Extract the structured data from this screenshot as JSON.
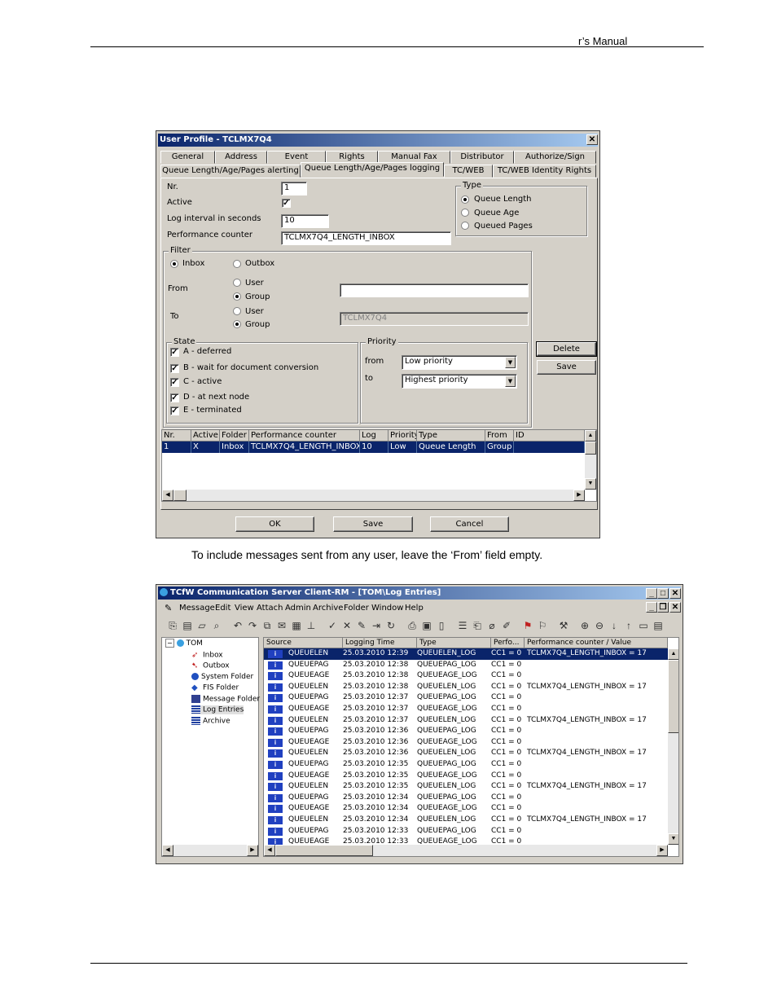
{
  "page": {
    "header_text": "r’s Manual",
    "caption": "To include messages sent from any user, leave the ‘From’ field empty."
  },
  "dialog": {
    "title": "User Profile - TCLMX7Q4",
    "close_label": "✕",
    "tabs_row1": [
      "General",
      "Address",
      "Event",
      "Rights",
      "Manual Fax",
      "Distributor",
      "Authorize/Sign"
    ],
    "tabs_row2": [
      "Queue Length/Age/Pages alerting",
      "Queue Length/Age/Pages logging",
      "TC/WEB",
      "TC/WEB Identity Rights"
    ],
    "nr_label": "Nr.",
    "nr_value": "1",
    "active_label": "Active",
    "active_checked": "✓",
    "interval_label": "Log interval in seconds",
    "interval_value": "10",
    "perf_label": "Performance counter",
    "perf_value": "TCLMX7Q4_LENGTH_INBOX",
    "type_group": "Type",
    "type_options": [
      "Queue Length",
      "Queue Age",
      "Queued Pages"
    ],
    "filter_group": "Filter",
    "inbox_label": "Inbox",
    "outbox_label": "Outbox",
    "from_label": "From",
    "to_label": "To",
    "user_label": "User",
    "group_label": "Group",
    "from_value": "",
    "to_value": "TCLMX7Q4",
    "state_group": "State",
    "states": [
      "A - deferred",
      "B - wait for document conversion",
      "C - active",
      "D - at next node",
      "E - terminated"
    ],
    "priority_group": "Priority",
    "prio_from_label": "from",
    "prio_from_value": "Low priority",
    "prio_to_label": "to",
    "prio_to_value": "Highest priority",
    "delete_label": "Delete",
    "save_side_label": "Save",
    "grid_headers": [
      "Nr.",
      "Active",
      "Folder",
      "Performance counter",
      "Log",
      "Priority",
      "Type",
      "From",
      "ID"
    ],
    "grid_row": [
      "1",
      "X",
      "Inbox",
      "TCLMX7Q4_LENGTH_INBOX",
      "10",
      "Low",
      "Queue Length",
      "Group",
      ""
    ],
    "ok_label": "OK",
    "save_label": "Save",
    "cancel_label": "Cancel"
  },
  "mainwin": {
    "title": "TCfW Communication Server Client-RM - [TOM\\Log Entries]",
    "menu": [
      "Message",
      "Edit",
      "View",
      "Attach",
      "Admin",
      "Archive",
      "Folder",
      "Window",
      "Help"
    ],
    "tree_root": "TOM",
    "tree_items": [
      "Inbox",
      "Outbox",
      "System Folder",
      "FIS Folder",
      "Message Folder",
      "Log Entries",
      "Archive"
    ],
    "list_headers": [
      "Source",
      "Logging Time",
      "Type",
      "Perfo...",
      "Performance counter / Value"
    ],
    "rows": [
      [
        "QUEUELEN",
        "25.03.2010 12:39",
        "QUEUELEN_LOG",
        "CC1 = 0",
        "TCLMX7Q4_LENGTH_INBOX = 17"
      ],
      [
        "QUEUEPAG",
        "25.03.2010 12:38",
        "QUEUEPAG_LOG",
        "CC1 = 0",
        ""
      ],
      [
        "QUEUEAGE",
        "25.03.2010 12:38",
        "QUEUEAGE_LOG",
        "CC1 = 0",
        ""
      ],
      [
        "QUEUELEN",
        "25.03.2010 12:38",
        "QUEUELEN_LOG",
        "CC1 = 0",
        "TCLMX7Q4_LENGTH_INBOX = 17"
      ],
      [
        "QUEUEPAG",
        "25.03.2010 12:37",
        "QUEUEPAG_LOG",
        "CC1 = 0",
        ""
      ],
      [
        "QUEUEAGE",
        "25.03.2010 12:37",
        "QUEUEAGE_LOG",
        "CC1 = 0",
        ""
      ],
      [
        "QUEUELEN",
        "25.03.2010 12:37",
        "QUEUELEN_LOG",
        "CC1 = 0",
        "TCLMX7Q4_LENGTH_INBOX = 17"
      ],
      [
        "QUEUEPAG",
        "25.03.2010 12:36",
        "QUEUEPAG_LOG",
        "CC1 = 0",
        ""
      ],
      [
        "QUEUEAGE",
        "25.03.2010 12:36",
        "QUEUEAGE_LOG",
        "CC1 = 0",
        ""
      ],
      [
        "QUEUELEN",
        "25.03.2010 12:36",
        "QUEUELEN_LOG",
        "CC1 = 0",
        "TCLMX7Q4_LENGTH_INBOX = 17"
      ],
      [
        "QUEUEPAG",
        "25.03.2010 12:35",
        "QUEUEPAG_LOG",
        "CC1 = 0",
        ""
      ],
      [
        "QUEUEAGE",
        "25.03.2010 12:35",
        "QUEUEAGE_LOG",
        "CC1 = 0",
        ""
      ],
      [
        "QUEUELEN",
        "25.03.2010 12:35",
        "QUEUELEN_LOG",
        "CC1 = 0",
        "TCLMX7Q4_LENGTH_INBOX = 17"
      ],
      [
        "QUEUEPAG",
        "25.03.2010 12:34",
        "QUEUEPAG_LOG",
        "CC1 = 0",
        ""
      ],
      [
        "QUEUEAGE",
        "25.03.2010 12:34",
        "QUEUEAGE_LOG",
        "CC1 = 0",
        ""
      ],
      [
        "QUEUELEN",
        "25.03.2010 12:34",
        "QUEUELEN_LOG",
        "CC1 = 0",
        "TCLMX7Q4_LENGTH_INBOX = 17"
      ],
      [
        "QUEUEPAG",
        "25.03.2010 12:33",
        "QUEUEPAG_LOG",
        "CC1 = 0",
        ""
      ],
      [
        "QUEUEAGE",
        "25.03.2010 12:33",
        "QUEUEAGE_LOG",
        "CC1 = 0",
        ""
      ]
    ]
  },
  "colors": {
    "titlebar": "#0a246a",
    "selection": "#0a246a",
    "face": "#d4d0c8"
  }
}
